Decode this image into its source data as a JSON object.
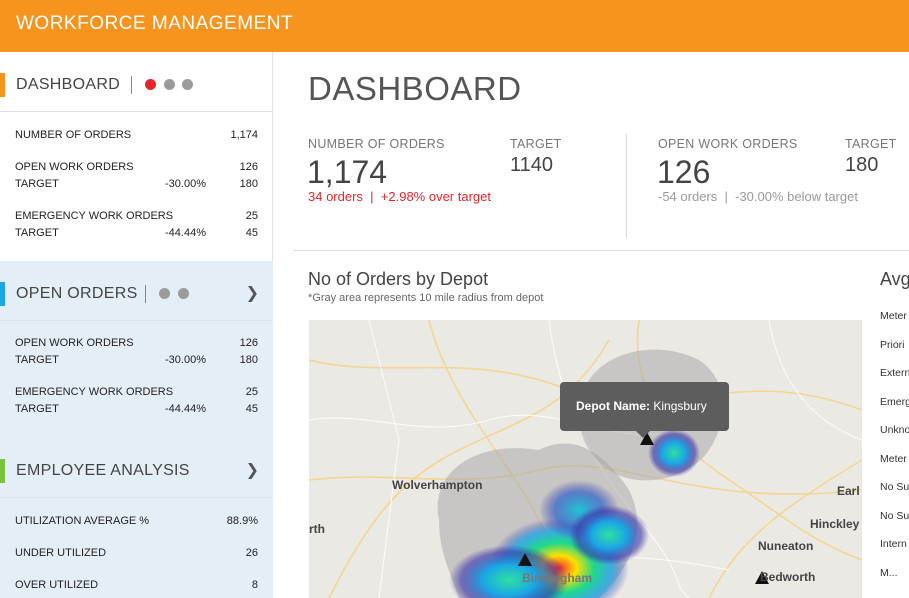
{
  "header": {
    "title": "WORKFORCE MANAGEMENT"
  },
  "colors": {
    "brand": "#f7941d",
    "alert_red": "#e8262a",
    "dot_gray": "#9b9b9b",
    "open_orders_accent": "#1aa6e6",
    "employee_accent": "#7cc242"
  },
  "sidebar": {
    "dashboard": {
      "label": "DASHBOARD",
      "rows": [
        {
          "label": "NUMBER OF ORDERS",
          "pct": "",
          "value": "1,174"
        },
        {
          "label": "OPEN WORK ORDERS",
          "pct": "",
          "value": "126"
        },
        {
          "label": "TARGET",
          "pct": "-30.00%",
          "value": "180"
        },
        {
          "label": "EMERGENCY WORK ORDERS",
          "pct": "",
          "value": "25"
        },
        {
          "label": "TARGET",
          "pct": "-44.44%",
          "value": "45"
        }
      ]
    },
    "open_orders": {
      "label": "OPEN ORDERS",
      "rows": [
        {
          "label": "OPEN WORK ORDERS",
          "pct": "",
          "value": "126"
        },
        {
          "label": "TARGET",
          "pct": "-30.00%",
          "value": "180"
        },
        {
          "label": "EMERGENCY WORK ORDERS",
          "pct": "",
          "value": "25"
        },
        {
          "label": "TARGET",
          "pct": "-44.44%",
          "value": "45"
        }
      ]
    },
    "employee": {
      "label": "EMPLOYEE ANALYSIS",
      "rows": [
        {
          "label": "UTILIZATION AVERAGE %",
          "pct": "",
          "value": "88.9%"
        },
        {
          "label": "UNDER UTILIZED",
          "pct": "",
          "value": "26"
        },
        {
          "label": "OVER UTILIZED",
          "pct": "",
          "value": "8"
        }
      ]
    },
    "chevron_icon": "chevron-right-icon"
  },
  "main": {
    "title": "DASHBOARD",
    "kpi1": {
      "label": "NUMBER OF ORDERS",
      "value": "1,174",
      "target_label": "TARGET",
      "target_value": "1140",
      "note_a": "34 orders",
      "note_sep": "|",
      "note_b": "+2.98% over target"
    },
    "kpi2": {
      "label": "OPEN WORK ORDERS",
      "value": "126",
      "target_label": "TARGET",
      "target_value": "180",
      "note_a": "-54 orders",
      "note_sep": "|",
      "note_b": "-30.00% below target"
    },
    "map": {
      "title": "No of Orders by Depot",
      "subtitle": "*Gray area represents 10 mile radius from depot",
      "tooltip_key": "Depot Name:",
      "tooltip_value": "Kingsbury",
      "places": [
        "Wolverhampton",
        "Earl",
        "Hinckley",
        "rth",
        "Nuneaton",
        "Bedworth",
        "Birmingham"
      ],
      "depot_icon": "triangle-marker-icon"
    },
    "right_panel": {
      "title": "Avg",
      "items": [
        "Meter",
        "Priori",
        "Extern",
        "Emerg",
        "Unkno",
        "Meter",
        "No Su",
        "No Su",
        "Intern",
        "M..."
      ]
    }
  }
}
